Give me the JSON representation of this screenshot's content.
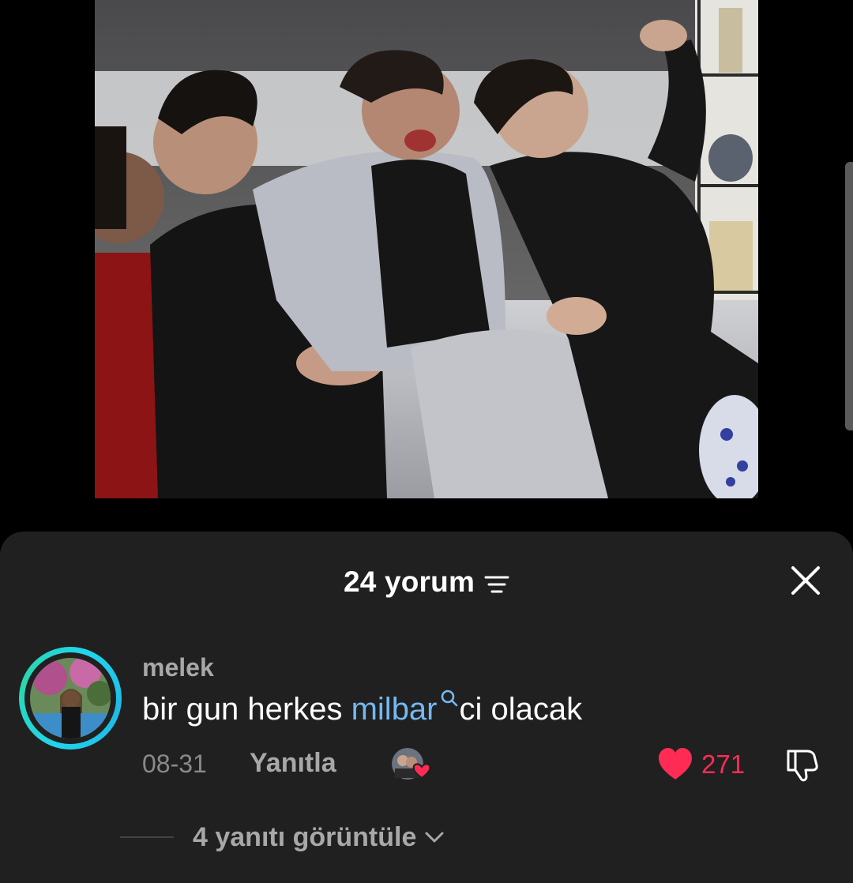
{
  "video": {
    "icon": "video-frame"
  },
  "sheet": {
    "comment_count_label": "24 yorum",
    "sort_icon": "sort-filter-icon",
    "close_icon": "close-icon"
  },
  "comment": {
    "username": "melek",
    "text_before": "bir gun herkes ",
    "mention": "milbar",
    "text_after": "ci olacak",
    "date": "08-31",
    "reply_label": "Yanıtla",
    "like_count": "271",
    "liked": true,
    "liked_by_creator": true
  },
  "replies": {
    "label": "4 yanıtı görüntüle"
  },
  "colors": {
    "sheet_bg": "#202020",
    "accent_like": "#fe2c55",
    "mention": "#74b8f2",
    "muted_text": "#a8a8a8",
    "avatar_ring": "#20d5ec"
  }
}
